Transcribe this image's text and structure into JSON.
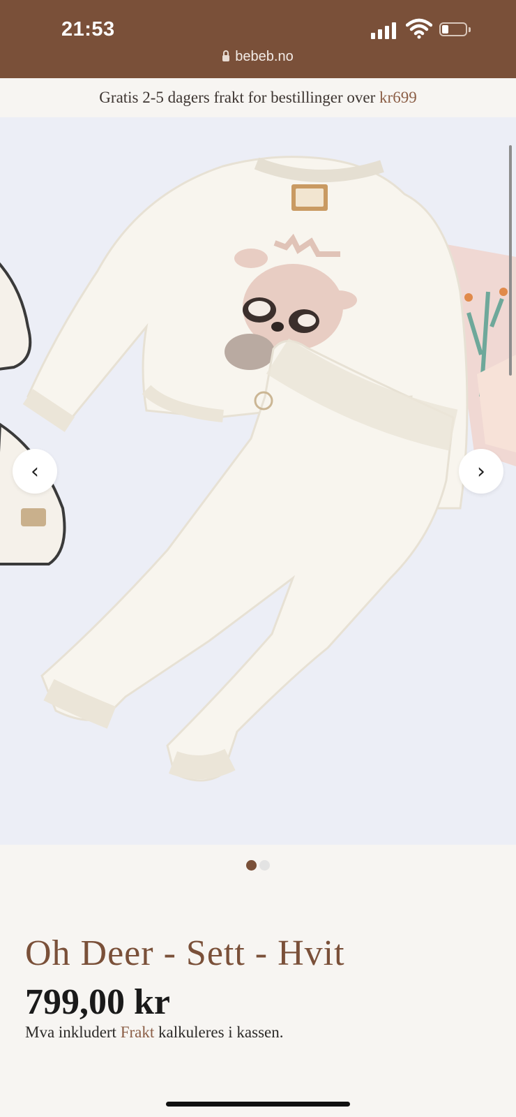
{
  "status_bar": {
    "time": "21:53"
  },
  "browser": {
    "url": "bebeb.no"
  },
  "banner": {
    "text": "Gratis 2-5 dagers frakt for bestillinger over ",
    "highlight": "kr699"
  },
  "gallery": {
    "prev_symbol": "‹",
    "next_symbol": "›",
    "current_index": 1,
    "total": 2
  },
  "product": {
    "title": "Oh Deer - Sett - Hvit",
    "price": "799,00 kr",
    "tax_prefix": "Mva inkludert ",
    "tax_link": "Frakt",
    "tax_suffix": " kalkuleres i kassen."
  },
  "colors": {
    "brand": "#7a5039",
    "accent": "#8b5e46",
    "background": "#f7f5f2"
  }
}
